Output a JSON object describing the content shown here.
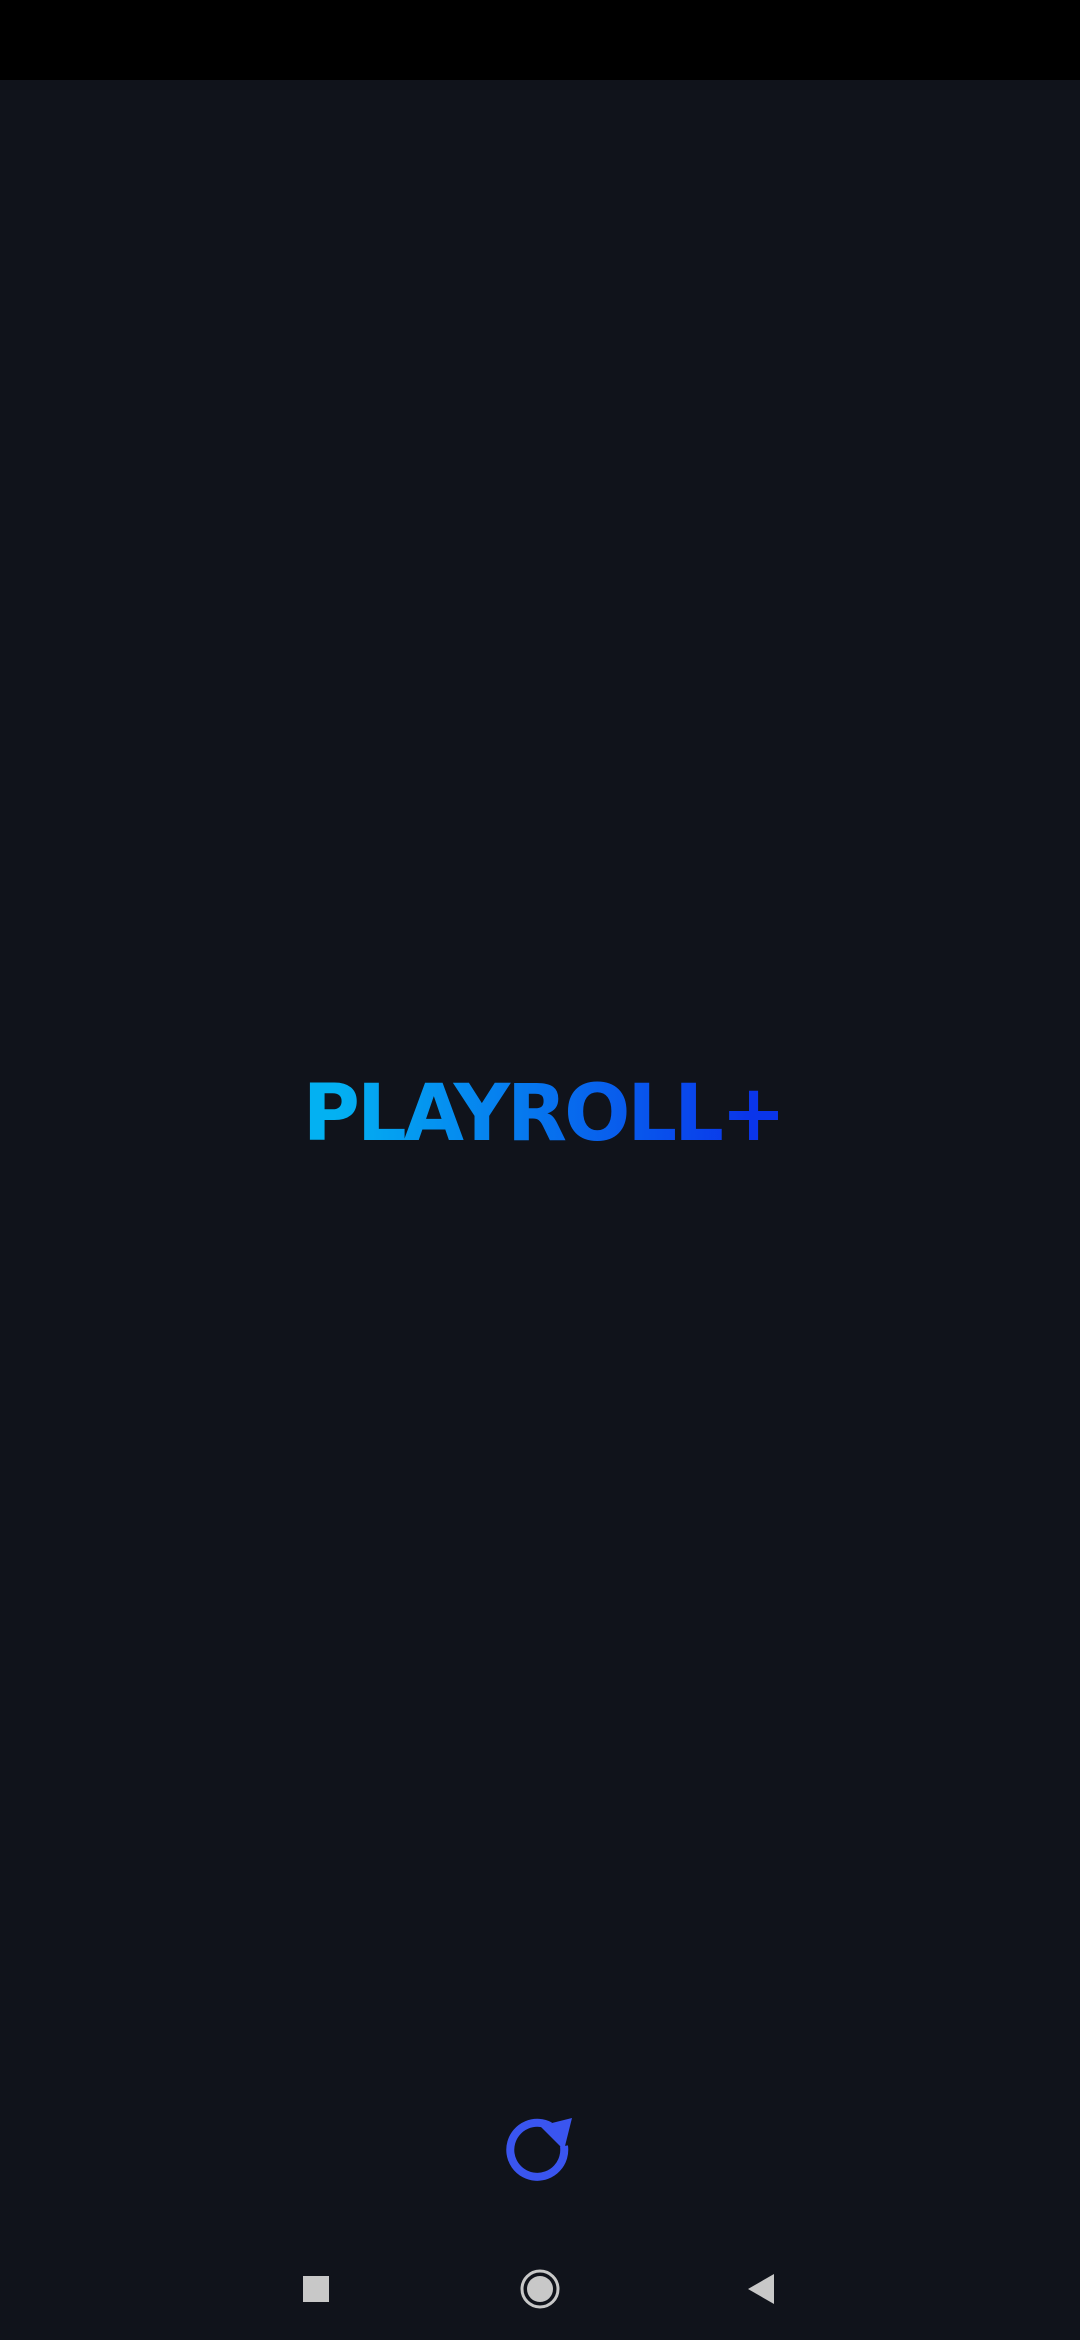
{
  "app": {
    "logo_text": "PLAYROLL+"
  },
  "colors": {
    "background": "#10131b",
    "status_bar": "#000000",
    "logo_gradient_start": "#03b1f2",
    "logo_gradient_end": "#0a35ea",
    "reload_icon": "#3a55f0",
    "nav_icons": "#c8c8c8"
  },
  "icons": {
    "reload": "reload-icon",
    "nav_recents": "square-icon",
    "nav_home": "circle-icon",
    "nav_back": "triangle-back-icon"
  }
}
